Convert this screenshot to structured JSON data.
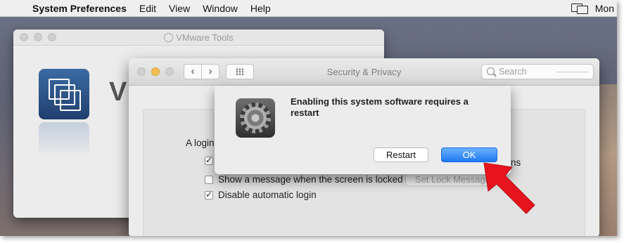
{
  "menubar": {
    "app_name": "System Preferences",
    "items": [
      "Edit",
      "View",
      "Window",
      "Help"
    ],
    "clock": "Mon"
  },
  "vmware_window": {
    "title": "VMware Tools",
    "partial_heading": "V"
  },
  "security_window": {
    "title": "Security & Privacy",
    "search_placeholder": "Search",
    "login_label": "A login",
    "options": [
      {
        "label": "",
        "checked": true,
        "suffix": "ns"
      },
      {
        "label": "Show a message when the screen is locked",
        "checked": false
      },
      {
        "label": "Disable automatic login",
        "checked": true
      }
    ],
    "set_lock_button": "Set Lock Message..."
  },
  "alert": {
    "message": "Enabling this system software requires a restart",
    "restart_button": "Restart",
    "ok_button": "OK"
  },
  "colors": {
    "accent_blue": "#1e79f1",
    "arrow_red": "#e8141d"
  }
}
